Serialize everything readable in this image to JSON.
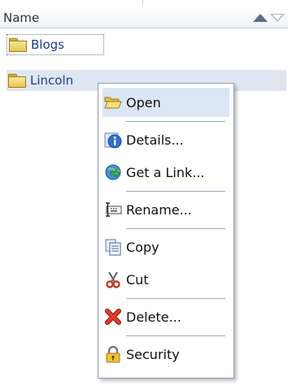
{
  "list": {
    "column_header": "Name",
    "rows": [
      {
        "label": "Blogs",
        "icon": "folder-icon"
      },
      {
        "label": "Lincoln",
        "icon": "folder-icon"
      }
    ]
  },
  "context_menu": {
    "items": [
      {
        "label": "Open",
        "icon": "open-folder-icon"
      },
      {
        "label": "Details...",
        "icon": "info-icon"
      },
      {
        "label": "Get a Link...",
        "icon": "link-icon"
      },
      {
        "label": "Rename...",
        "icon": "rename-icon"
      },
      {
        "label": "Copy",
        "icon": "copy-icon"
      },
      {
        "label": "Cut",
        "icon": "scissors-icon"
      },
      {
        "label": "Delete...",
        "icon": "delete-icon"
      },
      {
        "label": "Security",
        "icon": "lock-icon"
      }
    ]
  },
  "colors": {
    "selection": "#dfe6f1",
    "menu_highlight": "#dbe6f4",
    "link_text": "#1a3c8c"
  }
}
